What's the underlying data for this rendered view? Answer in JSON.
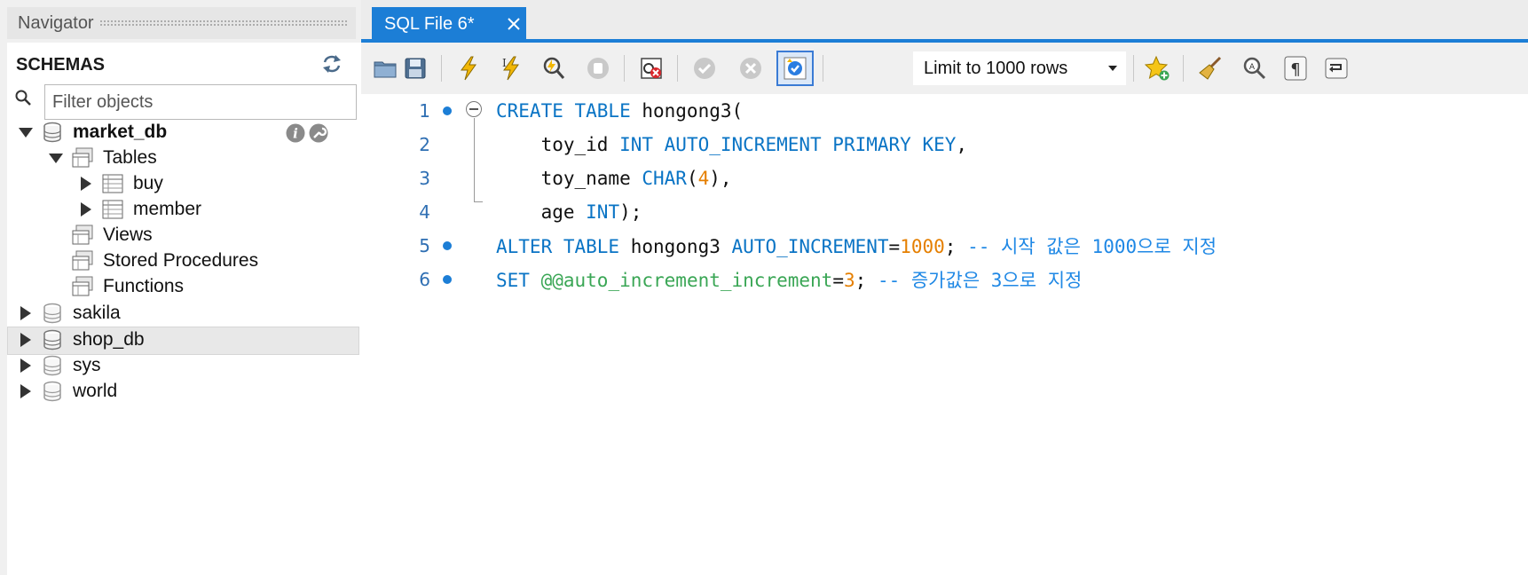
{
  "navigator": {
    "title": "Navigator",
    "schemas_title": "SCHEMAS",
    "filter_placeholder": "Filter objects",
    "tree": {
      "market_db": "market_db",
      "tables": "Tables",
      "buy": "buy",
      "member": "member",
      "views": "Views",
      "stored_procedures": "Stored Procedures",
      "functions": "Functions",
      "sakila": "sakila",
      "shop_db": "shop_db",
      "sys": "sys",
      "world": "world"
    }
  },
  "editor": {
    "tab_label": "SQL File 6*",
    "limit_select": "Limit to 1000 rows",
    "lines": {
      "l1": {
        "n": "1",
        "kw1": "CREATE TABLE",
        "rest": " hongong3("
      },
      "l2": {
        "n": "2",
        "indent": "    ",
        "id": "toy_id ",
        "kw": "INT AUTO_INCREMENT PRIMARY KEY",
        "end": ","
      },
      "l3": {
        "n": "3",
        "indent": "    ",
        "id": "toy_name ",
        "kw": "CHAR",
        "open": "(",
        "num": "4",
        "end": "),"
      },
      "l4": {
        "n": "4",
        "indent": "    ",
        "id": "age ",
        "kw": "INT",
        "end": ");"
      },
      "l5": {
        "n": "5",
        "kw1": "ALTER TABLE",
        "mid": " hongong3 ",
        "kw2": "AUTO_INCREMENT",
        "eq": "=",
        "num": "1000",
        "semi": "; ",
        "cmt": "-- 시작 값은 1000으로 지정"
      },
      "l6": {
        "n": "6",
        "kw1": "SET",
        "sp": " ",
        "var": "@@auto_increment_increment",
        "eq": "=",
        "num": "3",
        "semi": "; ",
        "cmt": "-- 증가값은 3으로 지정"
      }
    }
  },
  "colors": {
    "accent": "#1c7ed6",
    "keyword": "#0a74c5",
    "number": "#e57f00",
    "variable": "#3aa655",
    "comment": "#1f88e5"
  },
  "icons": [
    "refresh-icon",
    "search-icon",
    "info-icon",
    "wrench-icon",
    "open-folder-icon",
    "save-icon",
    "execute-lightning-icon",
    "execute-cursor-icon",
    "explain-icon",
    "stop-icon",
    "error-stop-icon",
    "commit-icon",
    "rollback-icon",
    "autocommit-icon",
    "star-add-icon",
    "beautify-broom-icon",
    "find-icon",
    "invisible-chars-icon",
    "word-wrap-icon"
  ]
}
